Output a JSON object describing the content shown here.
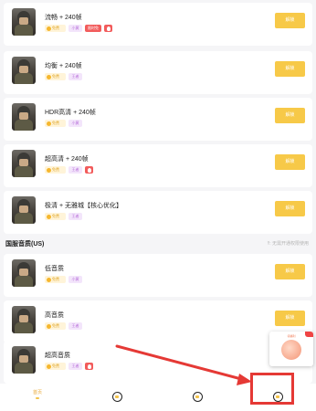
{
  "items": [
    {
      "name": "流畅 + 240帧",
      "free": "免费",
      "tier": "小黄",
      "badge_red": "限时免",
      "fire": true,
      "button": "解锁"
    },
    {
      "name": "均衡 + 240帧",
      "free": "免费",
      "tier": "王者",
      "badge_red": "",
      "fire": false,
      "button": "解锁"
    },
    {
      "name": "HDR高清 + 240帧",
      "free": "免费",
      "tier": "小黄",
      "badge_red": "",
      "fire": false,
      "button": "解锁"
    },
    {
      "name": "超高清 + 240帧",
      "free": "免费",
      "tier": "王者",
      "badge_red": "",
      "fire": true,
      "button": "解锁"
    },
    {
      "name": "极清 + 无雅城【核心优化】",
      "free": "免费",
      "tier": "王者",
      "badge_red": "",
      "fire": false,
      "button": "解锁"
    }
  ],
  "section": {
    "title": "国服音质(US)",
    "hint": "!!: 无需开通权限使用"
  },
  "audio_items": [
    {
      "name": "低音质",
      "free": "免费",
      "tier": "小黄",
      "button": "解锁"
    },
    {
      "name": "高音质",
      "free": "免费",
      "tier": "王者",
      "button": "解锁"
    },
    {
      "name": "超高音质",
      "free": "免费",
      "tier": "王者",
      "fire": true,
      "button": "解锁"
    }
  ],
  "float_card": {
    "label": "领福利"
  },
  "tabbar": {
    "tabs": [
      {
        "label": "首页",
        "icon": "home-icon",
        "active": true
      },
      {
        "label": "",
        "icon": "discover-icon",
        "active": false
      },
      {
        "label": "",
        "icon": "chart-icon",
        "active": false
      },
      {
        "label": "",
        "icon": "profile-icon",
        "active": false
      }
    ]
  },
  "colors": {
    "accent": "#f7c948",
    "highlight": "#e53935",
    "tag_red": "#f25c5c",
    "tag_purple_bg": "#f3e5fb"
  }
}
